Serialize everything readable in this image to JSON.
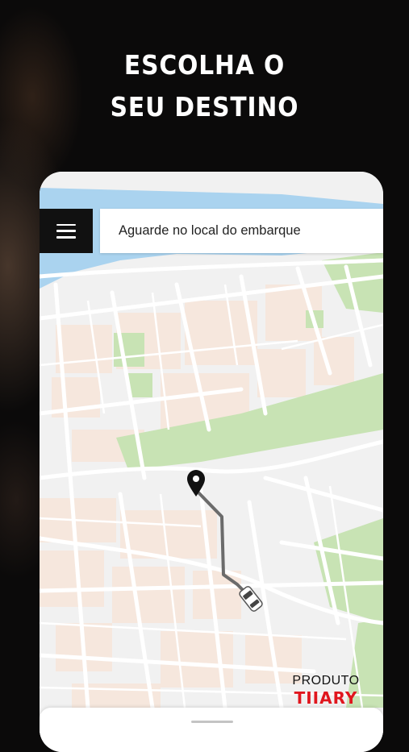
{
  "promo": {
    "headline_line1": "ESCOLHA O",
    "headline_line2": "SEU DESTINO"
  },
  "app": {
    "status_text": "Aguarde no local do embarque"
  },
  "brand": {
    "produto": "PRODUTO",
    "name": "TIIARY"
  },
  "icons": {
    "menu": "hamburger-menu-icon",
    "destination_pin": "map-pin-icon",
    "car": "car-icon"
  },
  "colors": {
    "background": "#0b0a0a",
    "water": "#aad3ef",
    "park": "#c8e3b4",
    "block": "#f6e7dd",
    "route": "#6b6b6b",
    "menu_button": "#111111",
    "brand_red": "#e0161e"
  }
}
